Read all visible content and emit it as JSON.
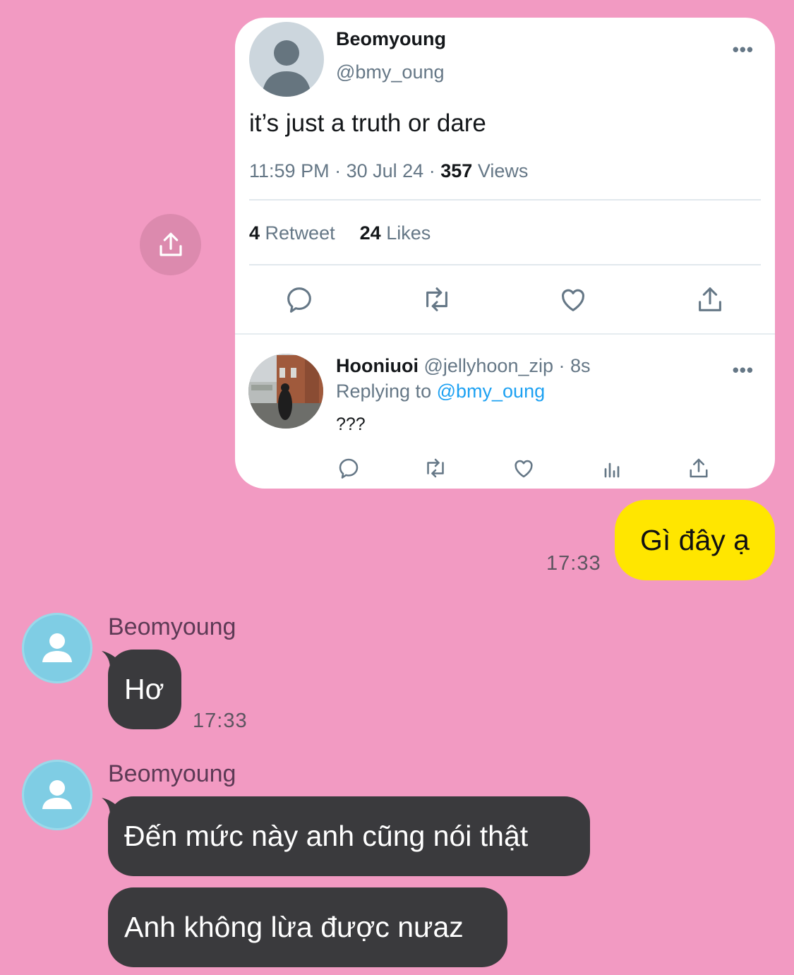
{
  "tweet": {
    "author_name": "Beomyoung",
    "author_handle": "@bmy_oung",
    "more_icon": "•••",
    "text": "it’s just a truth or dare",
    "time": "11:59 PM",
    "date": "30 Jul 24",
    "separator": "·",
    "views_count": "357",
    "views_label": "Views",
    "retweets_count": "4",
    "retweets_label": "Retweet",
    "likes_count": "24",
    "likes_label": "Likes"
  },
  "reply": {
    "author_name": "Hooniuoi",
    "author_handle": "@jellyhoon_zip",
    "age": "· 8s",
    "replying_prefix": "Replying to",
    "replying_handle": "@bmy_oung",
    "text": "???",
    "more_icon": "•••"
  },
  "sent": {
    "text": "Gì đây ạ",
    "time": "17:33"
  },
  "received": [
    {
      "sender": "Beomyoung",
      "messages": [
        {
          "text": "Hơ",
          "time": "17:33"
        }
      ]
    },
    {
      "sender": "Beomyoung",
      "messages": [
        {
          "text": "Đến mức này anh cũng nói thật"
        },
        {
          "text": "Anh không lừa được nưaz"
        }
      ]
    }
  ],
  "colors": {
    "background": "#f29ac2",
    "sent_bubble": "#ffe600",
    "received_bubble": "#3a3a3d",
    "mention": "#1da1f2",
    "avatar": "#7fcde4"
  },
  "icons": [
    "share-icon",
    "reply-icon",
    "retweet-icon",
    "like-icon",
    "views-icon",
    "more-icon",
    "person-icon"
  ]
}
